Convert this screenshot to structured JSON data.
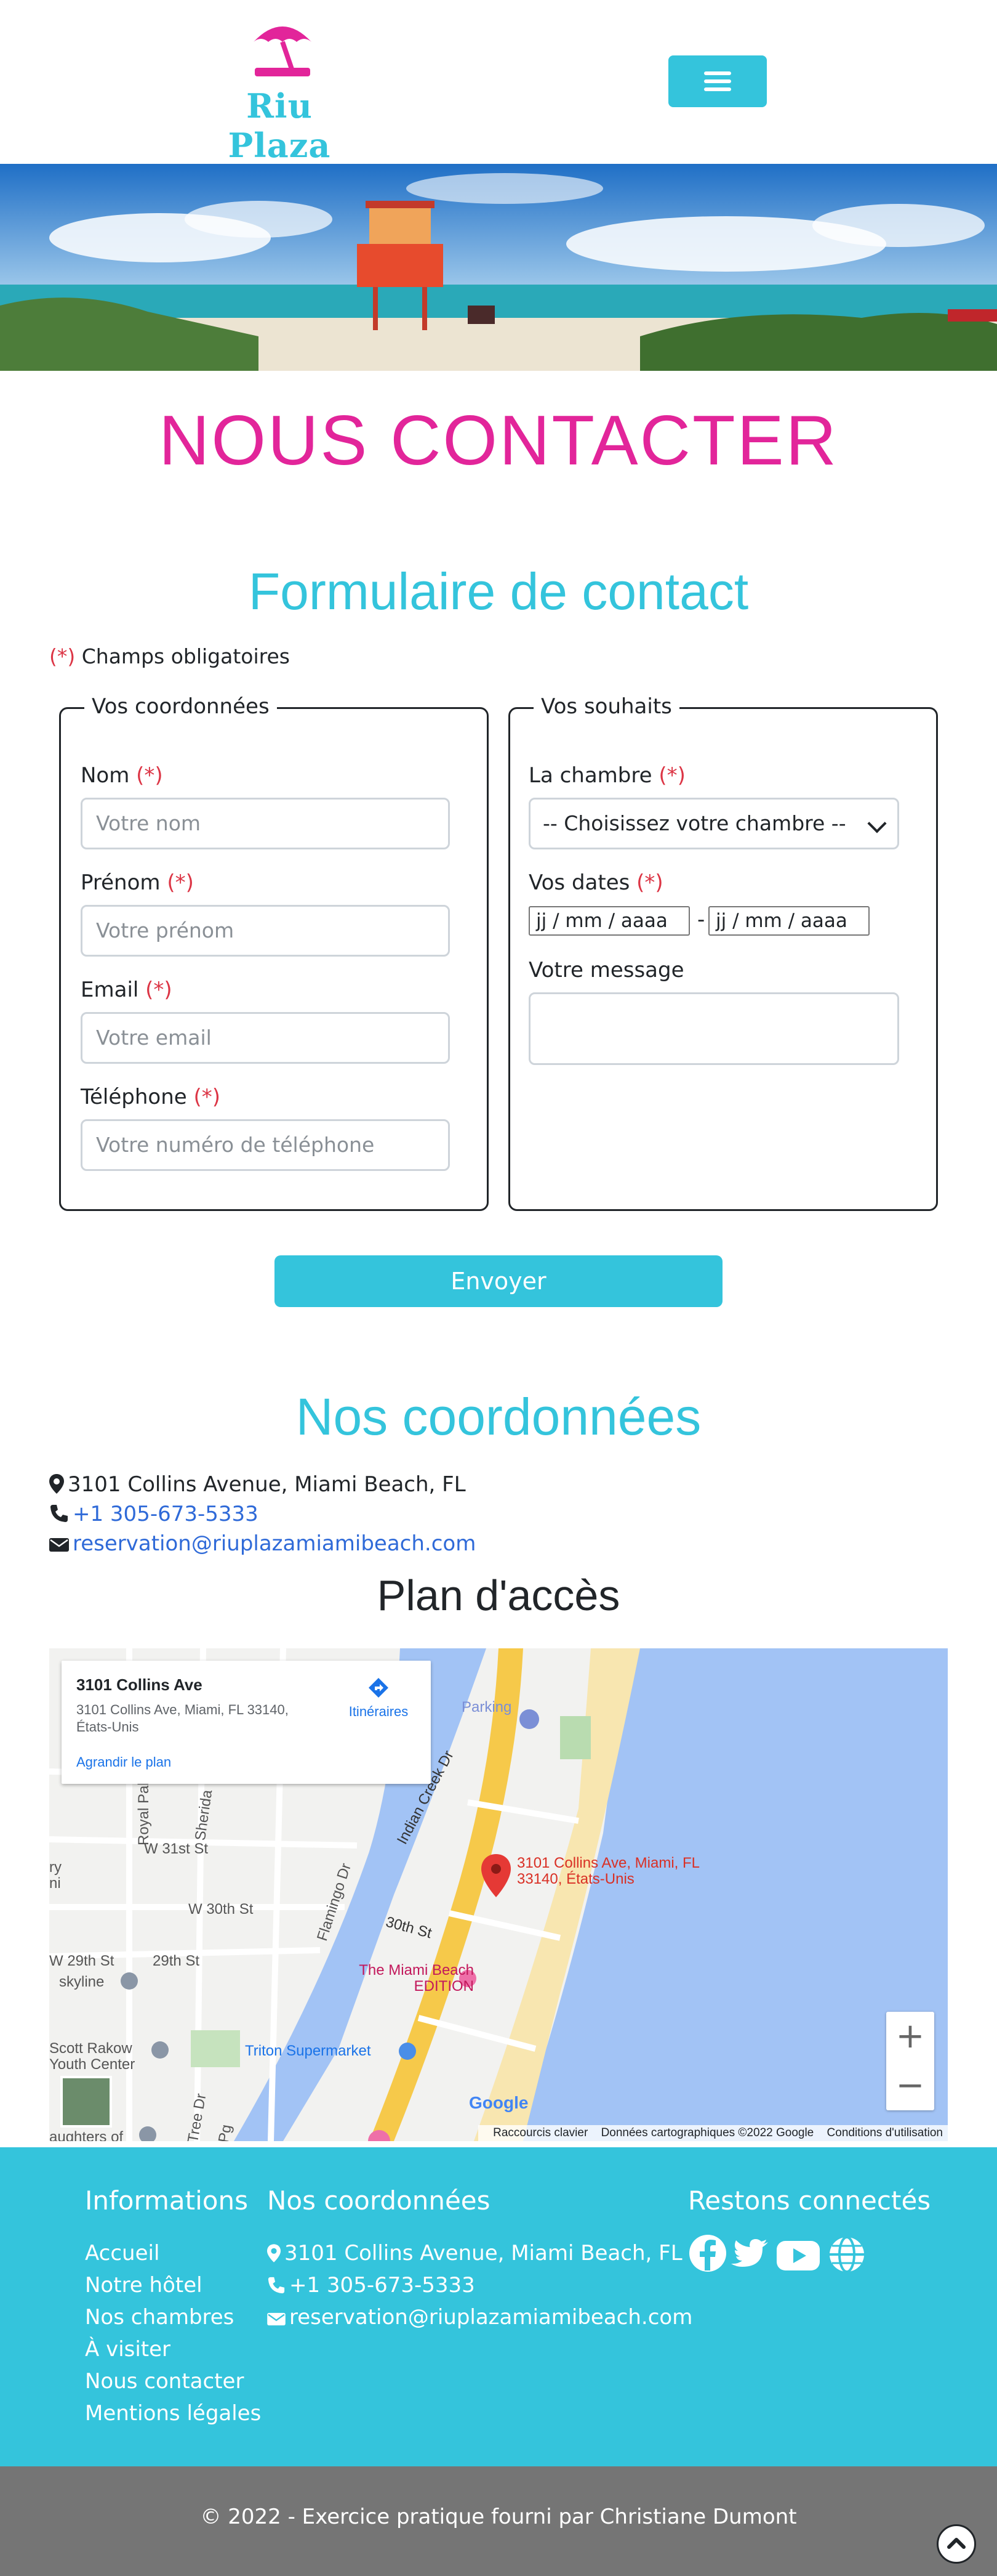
{
  "brand": {
    "name": "Riu Plaza",
    "accent": "#34c4dc",
    "pink": "#e2259a"
  },
  "header": {
    "menu_icon": "hamburger-menu-icon"
  },
  "page_title": "NOUS CONTACTER",
  "form": {
    "title": "Formulaire de contact",
    "required_marker": "(*)",
    "required_note": " Champs obligatoires",
    "coords": {
      "legend": "Vos coordonnées",
      "nom_label": "Nom ",
      "nom_placeholder": "Votre nom",
      "prenom_label": "Prénom ",
      "prenom_placeholder": "Votre prénom",
      "email_label": "Email ",
      "email_placeholder": "Votre email",
      "tel_label": "Téléphone ",
      "tel_placeholder": "Votre numéro de téléphone"
    },
    "wishes": {
      "legend": "Vos souhaits",
      "room_label": "La chambre ",
      "room_selected": "-- Choisissez votre chambre --",
      "dates_label": "Vos dates ",
      "date_from": "jj / mm / aaaa",
      "date_sep": "-",
      "date_to": "jj / mm / aaaa",
      "message_label": "Votre message"
    },
    "submit": "Envoyer"
  },
  "contact": {
    "title": "Nos coordonnées",
    "address": "3101 Collins Avenue, Miami Beach, FL",
    "phone": "+1 305-673-5333",
    "email": "reservation@riuplazamiamibeach.com"
  },
  "map": {
    "title": "Plan d'accès",
    "card_title": "3101 Collins Ave",
    "card_address": "3101 Collins Ave, Miami, FL 33140, États-Unis",
    "card_link": "Agrandir le plan",
    "directions": "Itinéraires",
    "pin_label": "3101 Collins Ave, Miami, FL 33140, États-Unis",
    "labels": {
      "parking": "Parking",
      "indian_creek": "Indian Creek Dr",
      "st31": "W 31st St",
      "st30": "W 30th St",
      "st29": "W 29th St",
      "st29b": "29th St",
      "st30b": "30th St",
      "royal_palm": "Royal Palm Ave",
      "flamingo": "Flamingo Dr",
      "sheridan": "Sherida",
      "skyline": "skyline",
      "scott": "Scott Rakow",
      "youth": "Youth Center",
      "miami_edition": "The Miami Beach EDITION",
      "triton": "Triton Supermarket",
      "daughters": "aughters of",
      "ry": "ry",
      "ni": "ni",
      "tree": "Tree Dr",
      "pg": "Pg"
    },
    "google": "Google",
    "footer_shortcuts": "Raccourcis clavier",
    "footer_data": "Données cartographiques ©2022 Google",
    "footer_terms": "Conditions d'utilisation",
    "zoom_in": "+",
    "zoom_out": "−"
  },
  "footer": {
    "info_title": "Informations",
    "links": [
      "Accueil",
      "Notre hôtel",
      "Nos chambres",
      "À visiter",
      "Nous contacter",
      "Mentions légales"
    ],
    "coords_title": "Nos coordonnées",
    "address": "3101 Collins Avenue, Miami Beach, FL",
    "phone": "+1 305-673-5333",
    "email": "reservation@riuplazamiamibeach.com",
    "social_title": "Restons connectés",
    "social_icons": [
      "facebook-icon",
      "twitter-icon",
      "youtube-icon",
      "globe-icon"
    ]
  },
  "copyright": "© 2022 - Exercice pratique fourni par Christiane Dumont"
}
